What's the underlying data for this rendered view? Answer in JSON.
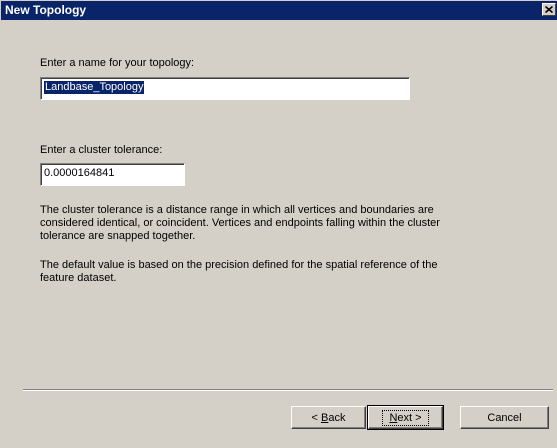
{
  "window": {
    "title": "New Topology"
  },
  "name_section": {
    "label": "Enter a name for your topology:",
    "value": "Landbase_Topology"
  },
  "tolerance_section": {
    "label": "Enter a cluster tolerance:",
    "value": "0.0000164841"
  },
  "help_text": {
    "paragraph1": "The cluster tolerance is a distance range in which all vertices and boundaries are considered identical, or coincident. Vertices and endpoints falling within the cluster tolerance are snapped together.",
    "paragraph2": "The default value is based on the precision defined for the spatial reference of the feature dataset."
  },
  "buttons": {
    "back_prefix": "< ",
    "back_mnemonic": "B",
    "back_rest": "ack",
    "next_mnemonic": "N",
    "next_rest": "ext >",
    "cancel": "Cancel"
  },
  "icons": {
    "close": "close-icon"
  },
  "colors": {
    "titlebar": "#0a246a",
    "face": "#d4d0c8",
    "selection": "#0a246a"
  }
}
